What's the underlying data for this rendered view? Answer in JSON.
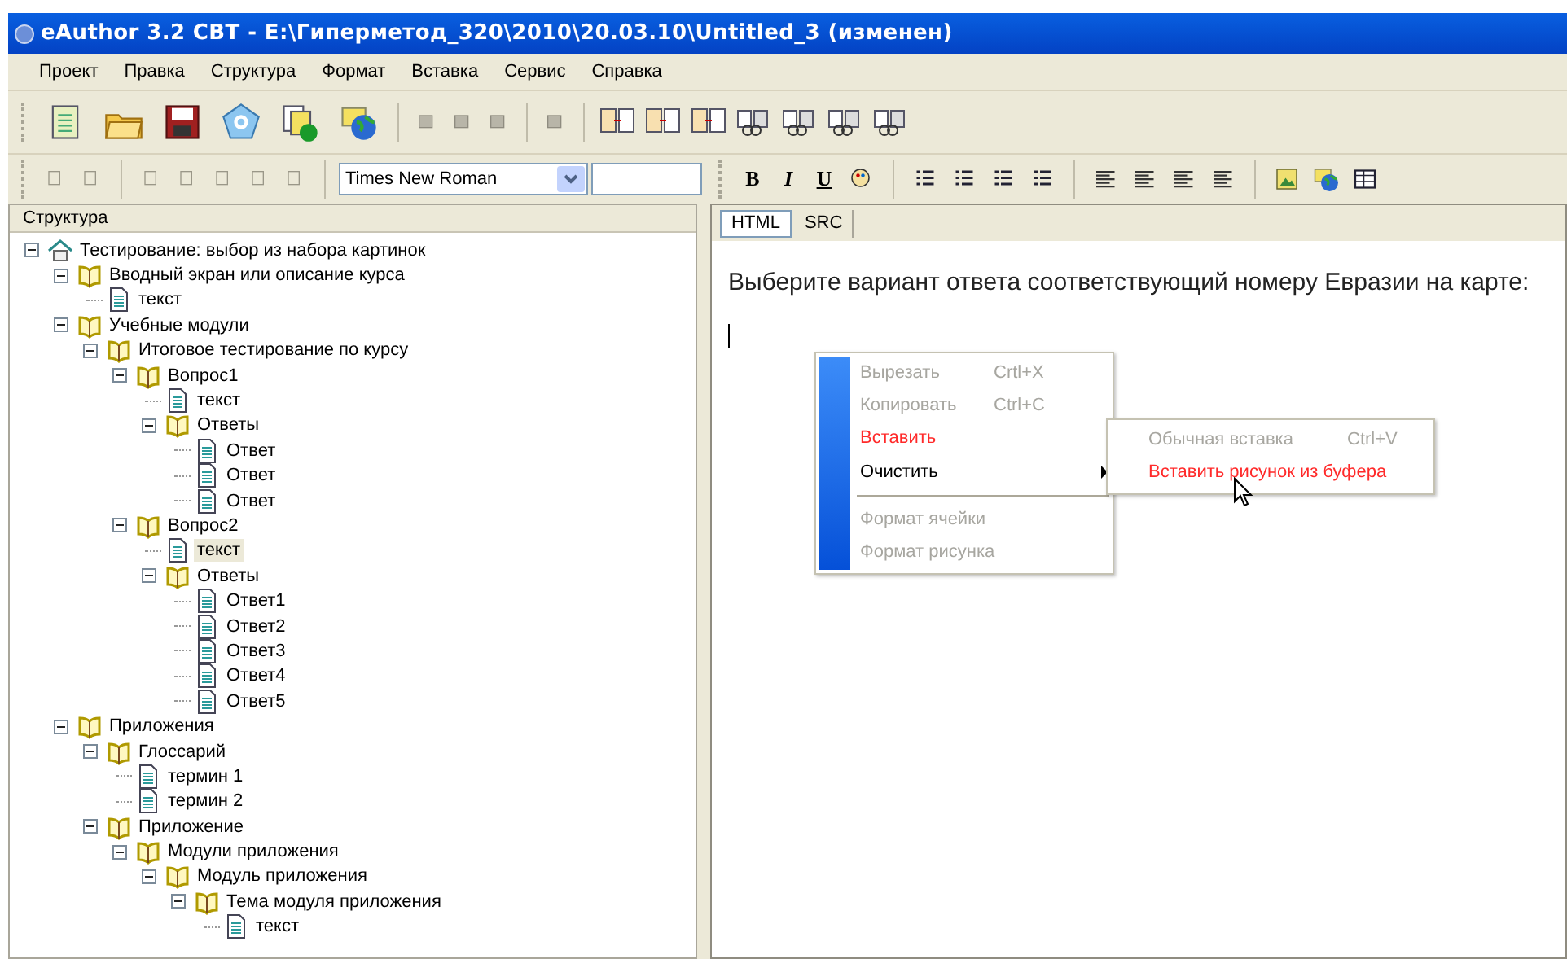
{
  "window": {
    "title": "eAuthor 3.2 CBT - E:\\Гиперметод_320\\2010\\20.03.10\\Untitled_3 (изменен)"
  },
  "menu": [
    "Проект",
    "Правка",
    "Структура",
    "Формат",
    "Вставка",
    "Сервис",
    "Справка"
  ],
  "format_bar": {
    "font": "Times New Roman",
    "buttons": [
      "B",
      "I",
      "U"
    ]
  },
  "structure_panel": {
    "title": "Структура",
    "tree": [
      {
        "label": "Тестирование: выбор из набора картинок",
        "kind": "home",
        "expanded": true,
        "selected": false,
        "children": [
          {
            "label": "Вводный экран или описание курса",
            "kind": "folder",
            "expanded": true,
            "selected": false,
            "children": [
              {
                "label": "текст",
                "kind": "page",
                "selected": false
              }
            ]
          },
          {
            "label": "Учебные модули",
            "kind": "folder",
            "expanded": true,
            "selected": false,
            "children": [
              {
                "label": "Итоговое тестирование по курсу",
                "kind": "folder",
                "expanded": true,
                "selected": false,
                "children": [
                  {
                    "label": "Вопрос1",
                    "kind": "folder",
                    "expanded": true,
                    "selected": false,
                    "children": [
                      {
                        "label": "текст",
                        "kind": "page",
                        "selected": false
                      },
                      {
                        "label": "Ответы",
                        "kind": "folder",
                        "expanded": true,
                        "selected": false,
                        "children": [
                          {
                            "label": "Ответ",
                            "kind": "page",
                            "selected": false
                          },
                          {
                            "label": "Ответ",
                            "kind": "page",
                            "selected": false
                          },
                          {
                            "label": "Ответ",
                            "kind": "page",
                            "selected": false
                          }
                        ]
                      }
                    ]
                  },
                  {
                    "label": "Вопрос2",
                    "kind": "folder",
                    "expanded": true,
                    "selected": false,
                    "children": [
                      {
                        "label": "текст",
                        "kind": "page",
                        "selected": true
                      },
                      {
                        "label": "Ответы",
                        "kind": "folder",
                        "expanded": true,
                        "selected": false,
                        "children": [
                          {
                            "label": "Ответ1",
                            "kind": "page",
                            "selected": false
                          },
                          {
                            "label": "Ответ2",
                            "kind": "page",
                            "selected": false
                          },
                          {
                            "label": "Ответ3",
                            "kind": "page",
                            "selected": false
                          },
                          {
                            "label": "Ответ4",
                            "kind": "page",
                            "selected": false
                          },
                          {
                            "label": "Ответ5",
                            "kind": "page",
                            "selected": false
                          }
                        ]
                      }
                    ]
                  }
                ]
              }
            ]
          },
          {
            "label": "Приложения",
            "kind": "folder",
            "expanded": true,
            "selected": false,
            "children": [
              {
                "label": "Глоссарий",
                "kind": "folder",
                "expanded": true,
                "selected": false,
                "children": [
                  {
                    "label": "термин 1",
                    "kind": "page",
                    "selected": false
                  },
                  {
                    "label": "термин 2",
                    "kind": "page",
                    "selected": false
                  }
                ]
              },
              {
                "label": "Приложение",
                "kind": "folder",
                "expanded": true,
                "selected": false,
                "children": [
                  {
                    "label": "Модули приложения",
                    "kind": "folder",
                    "expanded": true,
                    "selected": false,
                    "children": [
                      {
                        "label": "Модуль приложения",
                        "kind": "folder",
                        "expanded": true,
                        "selected": false,
                        "children": [
                          {
                            "label": "Тема модуля приложения",
                            "kind": "folder",
                            "expanded": true,
                            "selected": false,
                            "children": [
                              {
                                "label": "текст",
                                "kind": "page",
                                "selected": false
                              }
                            ]
                          }
                        ]
                      }
                    ]
                  }
                ]
              }
            ]
          }
        ]
      }
    ]
  },
  "editor": {
    "tabs": [
      {
        "label": "HTML",
        "selected": true
      },
      {
        "label": "SRC",
        "selected": false
      }
    ],
    "text": "Выберите вариант ответа соответствующий номеру Евразии на карте:"
  },
  "context_menu": {
    "items": [
      {
        "kind": "item",
        "label": "Вырезать",
        "shortcut": "Crtl+X",
        "disabled": true,
        "highlighted": false
      },
      {
        "kind": "item",
        "label": "Копировать",
        "shortcut": "Ctrl+C",
        "disabled": true,
        "highlighted": false
      },
      {
        "kind": "item",
        "label": "Вставить",
        "disabled": false,
        "highlighted": true
      },
      {
        "kind": "item",
        "label": "Очистить",
        "disabled": false,
        "highlighted": false,
        "has_submenu": true
      },
      {
        "kind": "separator"
      },
      {
        "kind": "item",
        "label": "Формат ячейки",
        "disabled": true,
        "highlighted": false
      },
      {
        "kind": "item",
        "label": "Формат рисунка",
        "disabled": true,
        "highlighted": false
      }
    ]
  },
  "submenu": {
    "items": [
      {
        "kind": "item",
        "label": "Обычная вставка",
        "shortcut": "Ctrl+V",
        "disabled": true,
        "highlighted": false
      },
      {
        "kind": "item",
        "label": "Вставить рисунок из буфера",
        "disabled": false,
        "highlighted": true
      }
    ]
  }
}
